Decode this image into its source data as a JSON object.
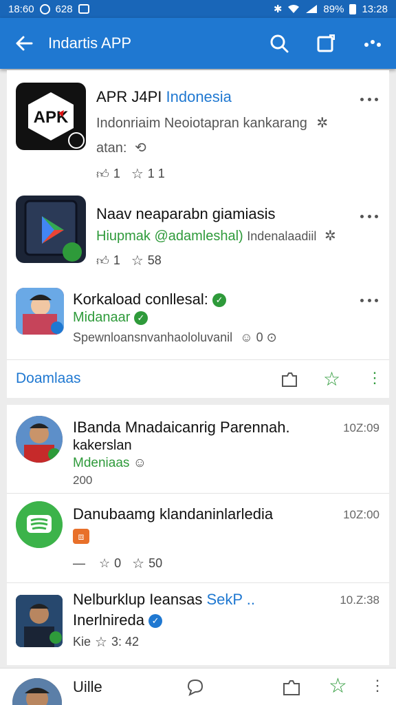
{
  "status_bar": {
    "time_left": "18:60",
    "left_text": "628",
    "battery": "89%",
    "time_right": "13:28"
  },
  "app_bar": {
    "title": "Indartis APP"
  },
  "apps": [
    {
      "name_prefix": "APR J4PI",
      "name_suffix": "Indonesia",
      "desc1": "Indonriaim Neoiotapran kankarang",
      "desc2": "atan:",
      "likes": "1",
      "stars": "1 1",
      "icon_text": "APK"
    },
    {
      "name": "Naav neaparabn giamiasis",
      "desc_green": "Hiupmak @adamleshal)",
      "desc_gray": "Indenalaadiil",
      "likes": "1",
      "stars": "58"
    },
    {
      "name": "Korkaload conllesal:",
      "desc_green": "Midanaar",
      "desc": "Spewnloansnvanhaololuvanil",
      "count": "0"
    }
  ],
  "section": {
    "title": "Doamlaas"
  },
  "posts": [
    {
      "title": "IBanda Mnadaicanrig Parennah.",
      "title2": "kakerslan",
      "sub": "Mdeniaas",
      "count": "200",
      "time": "10Z:09"
    },
    {
      "title": "Danubaamg klandaninlarledia",
      "dash": "—",
      "likes": "0",
      "stars": "50",
      "time": "10Z:00"
    },
    {
      "title": "Nelburklup Ieansas",
      "title_blue": "SekP ..",
      "title2": "Inerlnireda",
      "meta_text": "Kie",
      "stars": "3: 42",
      "time": "10.Z:38"
    }
  ],
  "bottom_bar": {
    "label": "Uille"
  },
  "colors": {
    "primary": "#1f78d1",
    "status": "#1966b8",
    "green": "#2e9a3a",
    "orange": "#e8702a"
  }
}
